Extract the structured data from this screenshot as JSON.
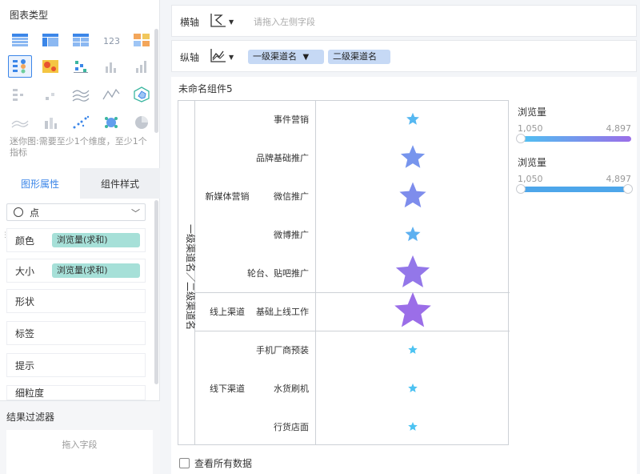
{
  "left_panel": {
    "chart_type_title": "图表类型",
    "chart_types": [
      {
        "icon": "table-icon"
      },
      {
        "icon": "cross-table-icon"
      },
      {
        "icon": "detail-table-icon"
      },
      {
        "icon": "kpi-number-icon",
        "text": "123"
      },
      {
        "icon": "multi-kpi-icon"
      },
      {
        "icon": "point-chart-icon",
        "selected": true
      },
      {
        "icon": "heatmap-icon"
      },
      {
        "icon": "scatter-bar-icon"
      },
      {
        "icon": "bar-chart-icon"
      },
      {
        "icon": "column-chart-icon"
      },
      {
        "icon": "dot-list-icon"
      },
      {
        "icon": "step-icon"
      },
      {
        "icon": "multi-line-icon"
      },
      {
        "icon": "line-chart-icon"
      },
      {
        "icon": "radar-icon"
      },
      {
        "icon": "area-chart-icon"
      },
      {
        "icon": "stacked-column-icon"
      },
      {
        "icon": "bubble-icon"
      },
      {
        "icon": "cluster-icon"
      },
      {
        "icon": "pie-chart-icon"
      }
    ],
    "mini_chart_hint": "迷你图:需要至少1个维度，至少1个指标",
    "tabs": [
      "图形属性",
      "组件样式"
    ],
    "shape_select": "点",
    "properties": [
      {
        "label": "颜色",
        "field": "浏览量(求和)"
      },
      {
        "label": "大小",
        "field": "浏览量(求和)"
      },
      {
        "label": "形状"
      },
      {
        "label": "标签"
      },
      {
        "label": "提示"
      },
      {
        "label": "细粒度"
      }
    ],
    "filter_title": "结果过滤器",
    "filter_placeholder": "拖入字段"
  },
  "x_axis": {
    "label": "横轴",
    "placeholder": "请拖入左侧字段",
    "icon": "axis-type-icon"
  },
  "y_axis": {
    "label": "纵轴",
    "icon": "line-axis-icon",
    "chips": [
      "一级渠道名",
      "二级渠道名"
    ],
    "filter_icon": "filter-icon"
  },
  "component_title": "未命名组件5",
  "view_all_label": "查看所有数据",
  "legends": [
    {
      "title": "浏览量",
      "min": "1,050",
      "max": "4,897",
      "colors": [
        "#4cc3f2",
        "#9b6ee8"
      ]
    },
    {
      "title": "浏览量",
      "min": "1,050",
      "max": "4,897",
      "color": "#4da6ea"
    }
  ],
  "chart_data": {
    "type": "scatter",
    "ylabel": "一级渠道名／二级渠道名",
    "groups": [
      {
        "name": "新媒体营销",
        "items": [
          "事件营销",
          "品牌基础推广",
          "微信推广",
          "微博推广",
          "轮台、贴吧推广"
        ]
      },
      {
        "name": "线上渠道",
        "items": [
          "基础上线工作"
        ]
      },
      {
        "name": "线下渠道",
        "items": [
          "手机厂商预装",
          "水货刷机",
          "行货店面"
        ]
      }
    ],
    "marker": "star",
    "size_color_field": "浏览量",
    "size_range": [
      1050,
      4897
    ],
    "values": [
      {
        "category": "事件营销",
        "value": 1550
      },
      {
        "category": "品牌基础推广",
        "value": 3150
      },
      {
        "category": "微信推广",
        "value": 3500
      },
      {
        "category": "微博推广",
        "value": 1900
      },
      {
        "category": "轮台、贴吧推广",
        "value": 4500
      },
      {
        "category": "基础上线工作",
        "value": 4897
      },
      {
        "category": "手机厂商预装",
        "value": 1050
      },
      {
        "category": "水货刷机",
        "value": 1080
      },
      {
        "category": "行货店面",
        "value": 1060
      }
    ]
  }
}
